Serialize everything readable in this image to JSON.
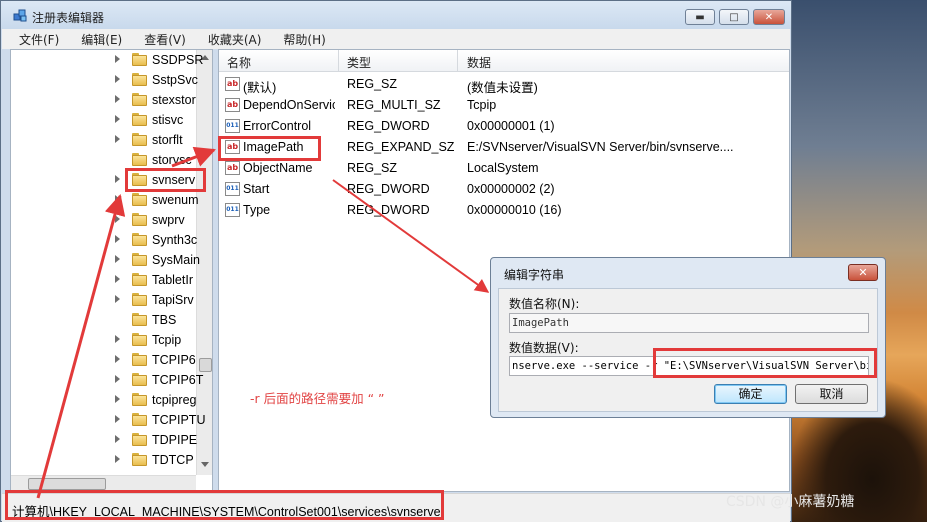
{
  "window": {
    "title": "注册表编辑器",
    "controls": [
      "minimize",
      "maximize",
      "close"
    ]
  },
  "menubar": [
    "文件(F)",
    "编辑(E)",
    "查看(V)",
    "收藏夹(A)",
    "帮助(H)"
  ],
  "tree": {
    "items": [
      "SSDPSR",
      "SstpSvc",
      "stexstor",
      "stisvc",
      "storflt",
      "storvsc",
      "svnserv",
      "swenum",
      "swprv",
      "Synth3c",
      "SysMain",
      "TabletIr",
      "TapiSrv",
      "TBS",
      "Tcpip",
      "TCPIP6",
      "TCPIP6T",
      "tcpipreg",
      "TCPIPTU",
      "TDPIPE",
      "TDTCP"
    ],
    "selected": "svnserv"
  },
  "list": {
    "columns": [
      "名称",
      "类型",
      "数据"
    ],
    "rows": [
      {
        "icon": "string-value-icon",
        "name": "(默认)",
        "type": "REG_SZ",
        "data": "(数值未设置)"
      },
      {
        "icon": "string-value-icon",
        "name": "DependOnService",
        "type": "REG_MULTI_SZ",
        "data": "Tcpip"
      },
      {
        "icon": "binary-value-icon",
        "name": "ErrorControl",
        "type": "REG_DWORD",
        "data": "0x00000001 (1)"
      },
      {
        "icon": "string-value-icon",
        "name": "ImagePath",
        "type": "REG_EXPAND_SZ",
        "data": "E:/SVNserver/VisualSVN Server/bin/svnserve...."
      },
      {
        "icon": "string-value-icon",
        "name": "ObjectName",
        "type": "REG_SZ",
        "data": "LocalSystem"
      },
      {
        "icon": "binary-value-icon",
        "name": "Start",
        "type": "REG_DWORD",
        "data": "0x00000002 (2)"
      },
      {
        "icon": "binary-value-icon",
        "name": "Type",
        "type": "REG_DWORD",
        "data": "0x00000010 (16)"
      }
    ]
  },
  "status": "计算机\\HKEY_LOCAL_MACHINE\\SYSTEM\\ControlSet001\\services\\svnserve",
  "dialog": {
    "title": "编辑字符串",
    "name_label": "数值名称(N):",
    "name_value": "ImagePath",
    "data_label": "数值数据(V):",
    "data_value": "nserve.exe --service -r \"E:\\SVNserver\\VisualSVN Server\\bin\"",
    "ok": "确定",
    "cancel": "取消"
  },
  "annotation": "-r 后面的路径需要加 “ ”",
  "watermark": "CSDN @小麻薯奶糖",
  "colors": {
    "annotation_red": "#e23a3a",
    "titlebar": "#c8d9ec",
    "selection": "#e23a3a"
  }
}
